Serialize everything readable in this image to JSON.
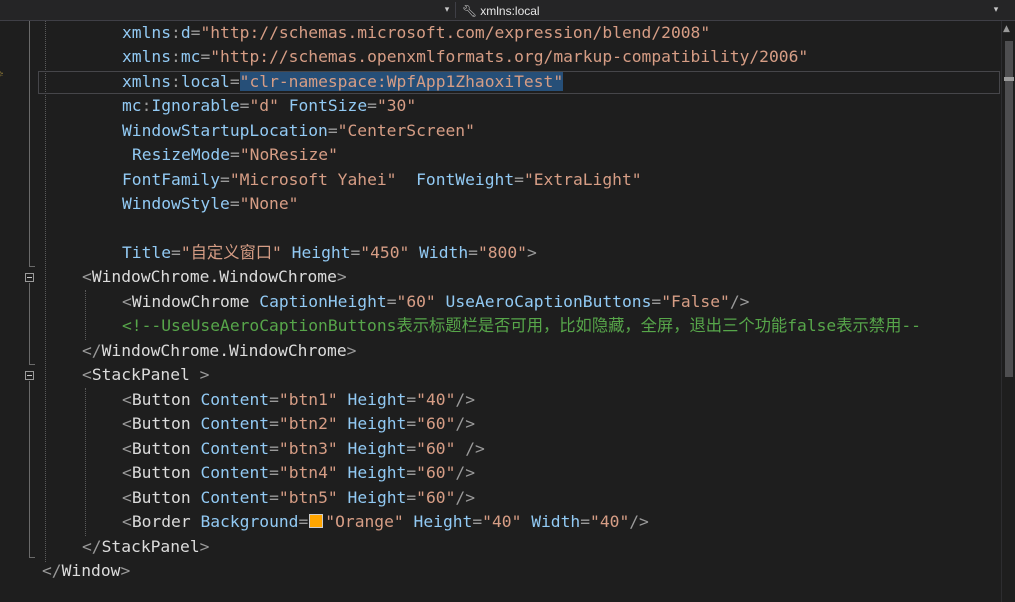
{
  "navbar": {
    "member_label": "xmlns:local",
    "left_arrow_icon": "chevron-down-icon",
    "right_arrow_icon": "chevron-down-icon",
    "member_icon": "wrench-icon"
  },
  "code": {
    "l1": {
      "attr": "xmlns",
      "sep": ":",
      "attr2": "d",
      "eq": "=",
      "val": "\"http://schemas.microsoft.com/expression/blend/2008\""
    },
    "l2": {
      "attr": "xmlns",
      "sep": ":",
      "attr2": "mc",
      "eq": "=",
      "val": "\"http://schemas.openxmlformats.org/markup-compatibility/2006\""
    },
    "l3": {
      "attr": "xmlns",
      "sep": ":",
      "attr2": "local",
      "eq": "=",
      "val": "\"clr-namespace:WpfApp1ZhaoxiTest\""
    },
    "l4": {
      "attr": "mc",
      "sep": ":",
      "attr2": "Ignorable",
      "eq": "=",
      "val": "\"d\"",
      "attr3": "FontSize",
      "val3": "\"30\""
    },
    "l5": {
      "attr": "WindowStartupLocation",
      "eq": "=",
      "val": "\"CenterScreen\""
    },
    "l6": {
      "attr": "ResizeMode",
      "eq": "=",
      "val": "\"NoResize\""
    },
    "l7": {
      "attr": "FontFamily",
      "eq": "=",
      "val": "\"Microsoft Yahei\"",
      "attr3": "FontWeight",
      "val3": "\"ExtraLight\""
    },
    "l8": {
      "attr": "WindowStyle",
      "eq": "=",
      "val": "\"None\""
    },
    "l10": {
      "attr": "Title",
      "eq": "=",
      "val": "\"自定义窗口\"",
      "attr3": "Height",
      "val3": "\"450\"",
      "attr4": "Width",
      "val4": "\"800\"",
      "close": ">"
    },
    "l11": {
      "open": "<",
      "tag": "WindowChrome.WindowChrome",
      "close": ">"
    },
    "l12": {
      "open": "<",
      "tag": "WindowChrome",
      "attr": "CaptionHeight",
      "val": "\"60\"",
      "attr3": "UseAeroCaptionButtons",
      "val3": "\"False\"",
      "close": "/>"
    },
    "l13": {
      "comment": "<!--UseUseAeroCaptionButtons表示标题栏是否可用，比如隐藏，全屏，退出三个功能false表示禁用--"
    },
    "l14": {
      "open": "</",
      "tag": "WindowChrome.WindowChrome",
      "close": ">"
    },
    "l15": {
      "open": "<",
      "tag": "StackPanel",
      "close": " >"
    },
    "l16": {
      "open": "<",
      "tag": "Button",
      "attr": "Content",
      "val": "\"btn1\"",
      "attr3": "Height",
      "val3": "\"40\"",
      "close": "/>"
    },
    "l17": {
      "open": "<",
      "tag": "Button",
      "attr": "Content",
      "val": "\"btn2\"",
      "attr3": "Height",
      "val3": "\"60\"",
      "close": "/>"
    },
    "l18": {
      "open": "<",
      "tag": "Button",
      "attr": "Content",
      "val": "\"btn3\"",
      "attr3": "Height",
      "val3": "\"60\"",
      "close": " />"
    },
    "l19": {
      "open": "<",
      "tag": "Button",
      "attr": "Content",
      "val": "\"btn4\"",
      "attr3": "Height",
      "val3": "\"60\"",
      "close": "/>"
    },
    "l20": {
      "open": "<",
      "tag": "Button",
      "attr": "Content",
      "val": "\"btn5\"",
      "attr3": "Height",
      "val3": "\"60\"",
      "close": "/>"
    },
    "l21": {
      "open": "<",
      "tag": "Border",
      "attr": "Background",
      "val": "\"Orange\"",
      "attr3": "Height",
      "val3": "\"40\"",
      "attr4": "Width",
      "val4": "\"40\"",
      "close": "/>",
      "swatch_color": "#ffa500"
    },
    "l22": {
      "open": "</",
      "tag": "StackPanel",
      "close": ">"
    },
    "l23": {
      "open": "</",
      "tag": "Window",
      "close": ">"
    }
  }
}
